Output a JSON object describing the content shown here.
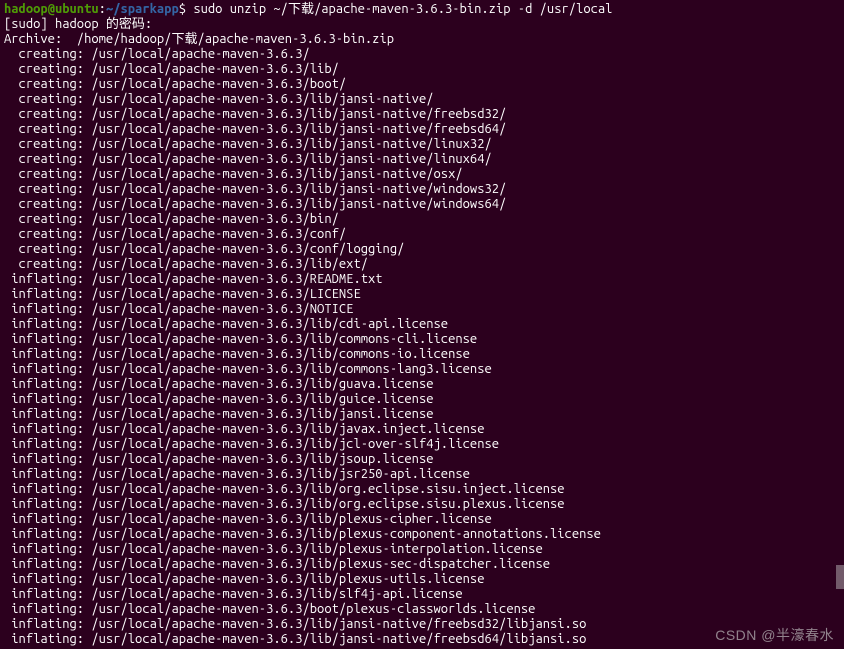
{
  "prompt": {
    "user": "hadoop",
    "at": "@",
    "host": "ubuntu",
    "colon": ":",
    "path": "~/sparkapp",
    "dollar": "$ ",
    "command": "sudo unzip ~/下载/apache-maven-3.6.3-bin.zip -d /usr/local"
  },
  "sudo_line": "[sudo] hadoop 的密码:",
  "archive_line": "Archive:  /home/hadoop/下载/apache-maven-3.6.3-bin.zip",
  "entries": [
    {
      "action": "creating",
      "path": "/usr/local/apache-maven-3.6.3/"
    },
    {
      "action": "creating",
      "path": "/usr/local/apache-maven-3.6.3/lib/"
    },
    {
      "action": "creating",
      "path": "/usr/local/apache-maven-3.6.3/boot/"
    },
    {
      "action": "creating",
      "path": "/usr/local/apache-maven-3.6.3/lib/jansi-native/"
    },
    {
      "action": "creating",
      "path": "/usr/local/apache-maven-3.6.3/lib/jansi-native/freebsd32/"
    },
    {
      "action": "creating",
      "path": "/usr/local/apache-maven-3.6.3/lib/jansi-native/freebsd64/"
    },
    {
      "action": "creating",
      "path": "/usr/local/apache-maven-3.6.3/lib/jansi-native/linux32/"
    },
    {
      "action": "creating",
      "path": "/usr/local/apache-maven-3.6.3/lib/jansi-native/linux64/"
    },
    {
      "action": "creating",
      "path": "/usr/local/apache-maven-3.6.3/lib/jansi-native/osx/"
    },
    {
      "action": "creating",
      "path": "/usr/local/apache-maven-3.6.3/lib/jansi-native/windows32/"
    },
    {
      "action": "creating",
      "path": "/usr/local/apache-maven-3.6.3/lib/jansi-native/windows64/"
    },
    {
      "action": "creating",
      "path": "/usr/local/apache-maven-3.6.3/bin/"
    },
    {
      "action": "creating",
      "path": "/usr/local/apache-maven-3.6.3/conf/"
    },
    {
      "action": "creating",
      "path": "/usr/local/apache-maven-3.6.3/conf/logging/"
    },
    {
      "action": "creating",
      "path": "/usr/local/apache-maven-3.6.3/lib/ext/"
    },
    {
      "action": "inflating",
      "path": "/usr/local/apache-maven-3.6.3/README.txt"
    },
    {
      "action": "inflating",
      "path": "/usr/local/apache-maven-3.6.3/LICENSE"
    },
    {
      "action": "inflating",
      "path": "/usr/local/apache-maven-3.6.3/NOTICE"
    },
    {
      "action": "inflating",
      "path": "/usr/local/apache-maven-3.6.3/lib/cdi-api.license"
    },
    {
      "action": "inflating",
      "path": "/usr/local/apache-maven-3.6.3/lib/commons-cli.license"
    },
    {
      "action": "inflating",
      "path": "/usr/local/apache-maven-3.6.3/lib/commons-io.license"
    },
    {
      "action": "inflating",
      "path": "/usr/local/apache-maven-3.6.3/lib/commons-lang3.license"
    },
    {
      "action": "inflating",
      "path": "/usr/local/apache-maven-3.6.3/lib/guava.license"
    },
    {
      "action": "inflating",
      "path": "/usr/local/apache-maven-3.6.3/lib/guice.license"
    },
    {
      "action": "inflating",
      "path": "/usr/local/apache-maven-3.6.3/lib/jansi.license"
    },
    {
      "action": "inflating",
      "path": "/usr/local/apache-maven-3.6.3/lib/javax.inject.license"
    },
    {
      "action": "inflating",
      "path": "/usr/local/apache-maven-3.6.3/lib/jcl-over-slf4j.license"
    },
    {
      "action": "inflating",
      "path": "/usr/local/apache-maven-3.6.3/lib/jsoup.license"
    },
    {
      "action": "inflating",
      "path": "/usr/local/apache-maven-3.6.3/lib/jsr250-api.license"
    },
    {
      "action": "inflating",
      "path": "/usr/local/apache-maven-3.6.3/lib/org.eclipse.sisu.inject.license"
    },
    {
      "action": "inflating",
      "path": "/usr/local/apache-maven-3.6.3/lib/org.eclipse.sisu.plexus.license"
    },
    {
      "action": "inflating",
      "path": "/usr/local/apache-maven-3.6.3/lib/plexus-cipher.license"
    },
    {
      "action": "inflating",
      "path": "/usr/local/apache-maven-3.6.3/lib/plexus-component-annotations.license"
    },
    {
      "action": "inflating",
      "path": "/usr/local/apache-maven-3.6.3/lib/plexus-interpolation.license"
    },
    {
      "action": "inflating",
      "path": "/usr/local/apache-maven-3.6.3/lib/plexus-sec-dispatcher.license"
    },
    {
      "action": "inflating",
      "path": "/usr/local/apache-maven-3.6.3/lib/plexus-utils.license"
    },
    {
      "action": "inflating",
      "path": "/usr/local/apache-maven-3.6.3/lib/slf4j-api.license"
    },
    {
      "action": "inflating",
      "path": "/usr/local/apache-maven-3.6.3/boot/plexus-classworlds.license"
    },
    {
      "action": "inflating",
      "path": "/usr/local/apache-maven-3.6.3/lib/jansi-native/freebsd32/libjansi.so"
    },
    {
      "action": "inflating",
      "path": "/usr/local/apache-maven-3.6.3/lib/jansi-native/freebsd64/libjansi.so"
    }
  ],
  "watermark": "CSDN @半濠春水"
}
